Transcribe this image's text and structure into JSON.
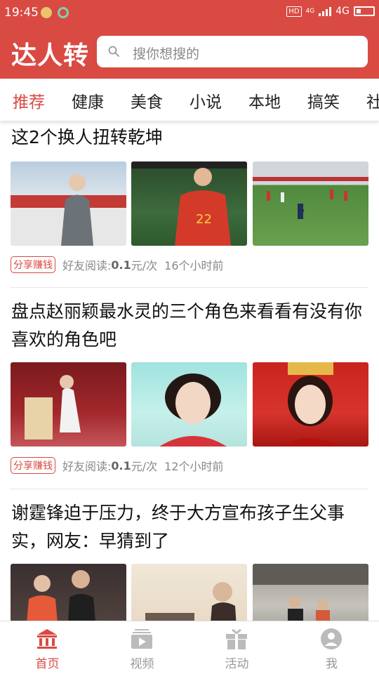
{
  "status_bar": {
    "time": "19:45",
    "hd": "HD",
    "network": "4G",
    "net_small": "4G"
  },
  "header": {
    "logo": "达人转",
    "search_placeholder": "搜你想搜的"
  },
  "tabs": [
    {
      "label": "推荐",
      "active": true
    },
    {
      "label": "健康"
    },
    {
      "label": "美食"
    },
    {
      "label": "小说"
    },
    {
      "label": "本地"
    },
    {
      "label": "搞笑"
    },
    {
      "label": "社"
    }
  ],
  "articles": [
    {
      "title": "这2个换人扭转乾坤",
      "share_label": "分享赚钱",
      "reward_prefix": "好友阅读:",
      "reward_value": "0.1",
      "reward_suffix": "元/次",
      "time": "16个小时前"
    },
    {
      "title": "盘点赵丽颖最水灵的三个角色来看看有没有你喜欢的角色吧",
      "share_label": "分享赚钱",
      "reward_prefix": "好友阅读:",
      "reward_value": "0.1",
      "reward_suffix": "元/次",
      "time": "12个小时前"
    },
    {
      "title": "谢霆锋迫于压力，终于大方宣布孩子生父事实，网友：早猜到了"
    }
  ],
  "bottom_nav": [
    {
      "label": "首页",
      "icon": "home-icon",
      "active": true
    },
    {
      "label": "视频",
      "icon": "video-icon"
    },
    {
      "label": "活动",
      "icon": "gift-icon"
    },
    {
      "label": "我",
      "icon": "profile-icon"
    }
  ],
  "colors": {
    "brand": "#d94a43",
    "muted": "#888888",
    "inactive_nav": "#999999"
  }
}
